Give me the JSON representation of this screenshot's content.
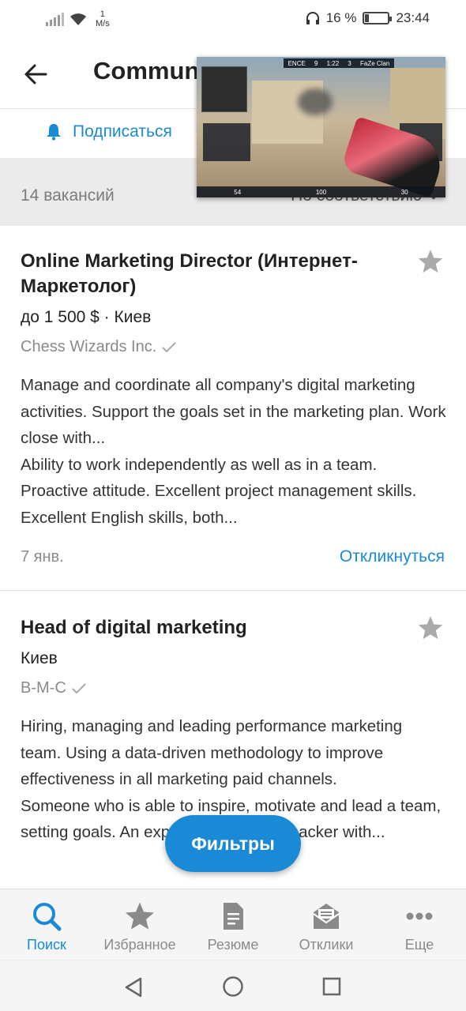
{
  "status_bar": {
    "speed_value": "1",
    "speed_unit": "M/s",
    "battery": "16 %",
    "time": "23:44",
    "battery_level": 0.16
  },
  "app_bar": {
    "title": "Commun",
    "back_icon": "arrow-left-icon"
  },
  "subscribe": {
    "label": "Подписаться",
    "icon": "bell-icon"
  },
  "list_header": {
    "count": "14 вакансий",
    "sort_label": "По соответствию",
    "sort_icon": "chevron-down-icon"
  },
  "video_overlay": {
    "team_left": "ENCE",
    "score_left": "9",
    "timer": "1:22",
    "score_right": "3",
    "team_right": "FaZe Clan",
    "health": "54",
    "armor": "100",
    "ammo": "30"
  },
  "jobs": [
    {
      "title": "Online Marketing Director (Интернет-Маркетолог)",
      "salary": "до 1 500  $  · Киев",
      "company": "Chess Wizards Inc.",
      "verified_icon": "check-icon",
      "description": "Manage and coordinate all company's digital marketing activities. Support the goals set in the marketing plan. Work close with...\nAbility to work independently as well as in a team. Proactive attitude. Excellent project management skills. Excellent English skills, both...",
      "date": "7 янв.",
      "respond_label": "Откликнуться",
      "star_icon": "star-icon"
    },
    {
      "title": "Head of digital marketing",
      "salary": "Киев",
      "company": "B-M-C",
      "verified_icon": "check-icon",
      "description": "Hiring, managing and leading performance marketing team. Using a data-driven methodology to improve effectiveness in all marketing paid channels.\nSomeone who is able to inspire, motivate and lead a team, setting goals. An experienced growth hacker with...",
      "star_icon": "star-icon"
    }
  ],
  "fab": {
    "label": "Фильтры"
  },
  "bottom_nav": [
    {
      "label": "Поиск",
      "icon": "search-icon",
      "active": true
    },
    {
      "label": "Избранное",
      "icon": "star-icon",
      "active": false
    },
    {
      "label": "Резюме",
      "icon": "document-icon",
      "active": false
    },
    {
      "label": "Отклики",
      "icon": "envelope-icon",
      "active": false
    },
    {
      "label": "Еще",
      "icon": "more-icon",
      "active": false
    }
  ],
  "colors": {
    "accent": "#1a8ad6",
    "muted_text": "#8a8a8a",
    "sort_bar_bg": "#ebebeb"
  }
}
